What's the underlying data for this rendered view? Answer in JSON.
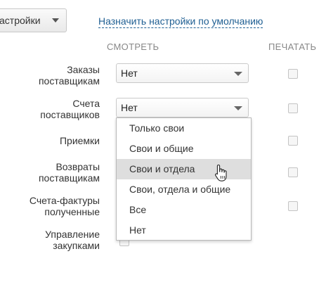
{
  "toolbar": {
    "settings_label": "астройки",
    "defaults_link": "Назначить настройки по умолчанию"
  },
  "columns": {
    "view": "СМОТРЕТЬ",
    "print": "ПЕЧАТАТЬ"
  },
  "rows": [
    {
      "label_line1": "Заказы",
      "label_line2": "поставщикам",
      "value": "Нет"
    },
    {
      "label_line1": "Счета",
      "label_line2": "поставщиков",
      "value": "Нет"
    },
    {
      "label_line1": "Приемки",
      "label_line2": ""
    },
    {
      "label_line1": "Возвраты",
      "label_line2": "поставщикам"
    },
    {
      "label_line1": "Счета-фактуры",
      "label_line2": "полученные"
    },
    {
      "label_line1": "Управление",
      "label_line2": "закупками"
    }
  ],
  "dropdown": {
    "options": [
      "Только свои",
      "Свои и общие",
      "Свои и отдела",
      "Свои, отдела и общие",
      "Все",
      "Нет"
    ],
    "hovered": "Свои и отдела"
  }
}
